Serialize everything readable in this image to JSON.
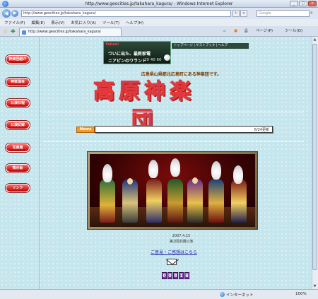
{
  "window": {
    "title": "http://www.geocities.jp/takahara_kagura/ - Windows Internet Explorer",
    "minimize": "_",
    "maximize": "□",
    "close": "×"
  },
  "address": {
    "back": "◀",
    "forward": "▶",
    "url": "http://www.geocities.jp/takahara_kagura/",
    "refresh": "↻",
    "stop": "×",
    "search_placeholder": "Google",
    "search_icon": "⌕"
  },
  "menu": [
    "ファイル(F)",
    "編集(E)",
    "表示(V)",
    "お気に入り(A)",
    "ツール(T)",
    "ヘルプ(H)"
  ],
  "tab": {
    "fav_star": "☆",
    "add_fav": "✚",
    "label": "http://www.geocities.jp/takahara_kagura/"
  },
  "commands": {
    "home": "⌂",
    "feeds": "▣",
    "print": "⎙",
    "page": "ページ(P)",
    "tools": "ツール(O)"
  },
  "sidebar": {
    "items": [
      "神楽団紹介",
      "神楽演目",
      "公演日程",
      "公演記録",
      "写真館",
      "掲示板",
      "リンク"
    ]
  },
  "ad": {
    "logo": "Yahoo!",
    "line1": "ついに出た、最新家電",
    "line2": "ニアピンのワラント",
    "numbers": "20 40 60",
    "links": "トップページ | ゲストブック | ヘルプ"
  },
  "site": {
    "tagline": "広島県山県郡北広島町にある神楽団です。",
    "title": "高原神楽団"
  },
  "news": {
    "badge": "News",
    "text": "6/24更新"
  },
  "photo": {
    "caption_date": "2007.4.15",
    "caption_title": "第2回定期公演"
  },
  "contact": {
    "link": "ご意見・ご感想はこちら"
  },
  "counter": {
    "digits": [
      "0",
      "0",
      "8",
      "1",
      "6"
    ]
  },
  "status": {
    "zone": "インターネット",
    "zoom": "100%"
  },
  "colors": {
    "page_bg": "#c6e6ee",
    "nav_button": "#d41a1a",
    "title_fill": "#5b3bdc",
    "title_outline": "#e23a3a",
    "news_badge": "#f59a1a",
    "counter": "#8b3fc0"
  }
}
